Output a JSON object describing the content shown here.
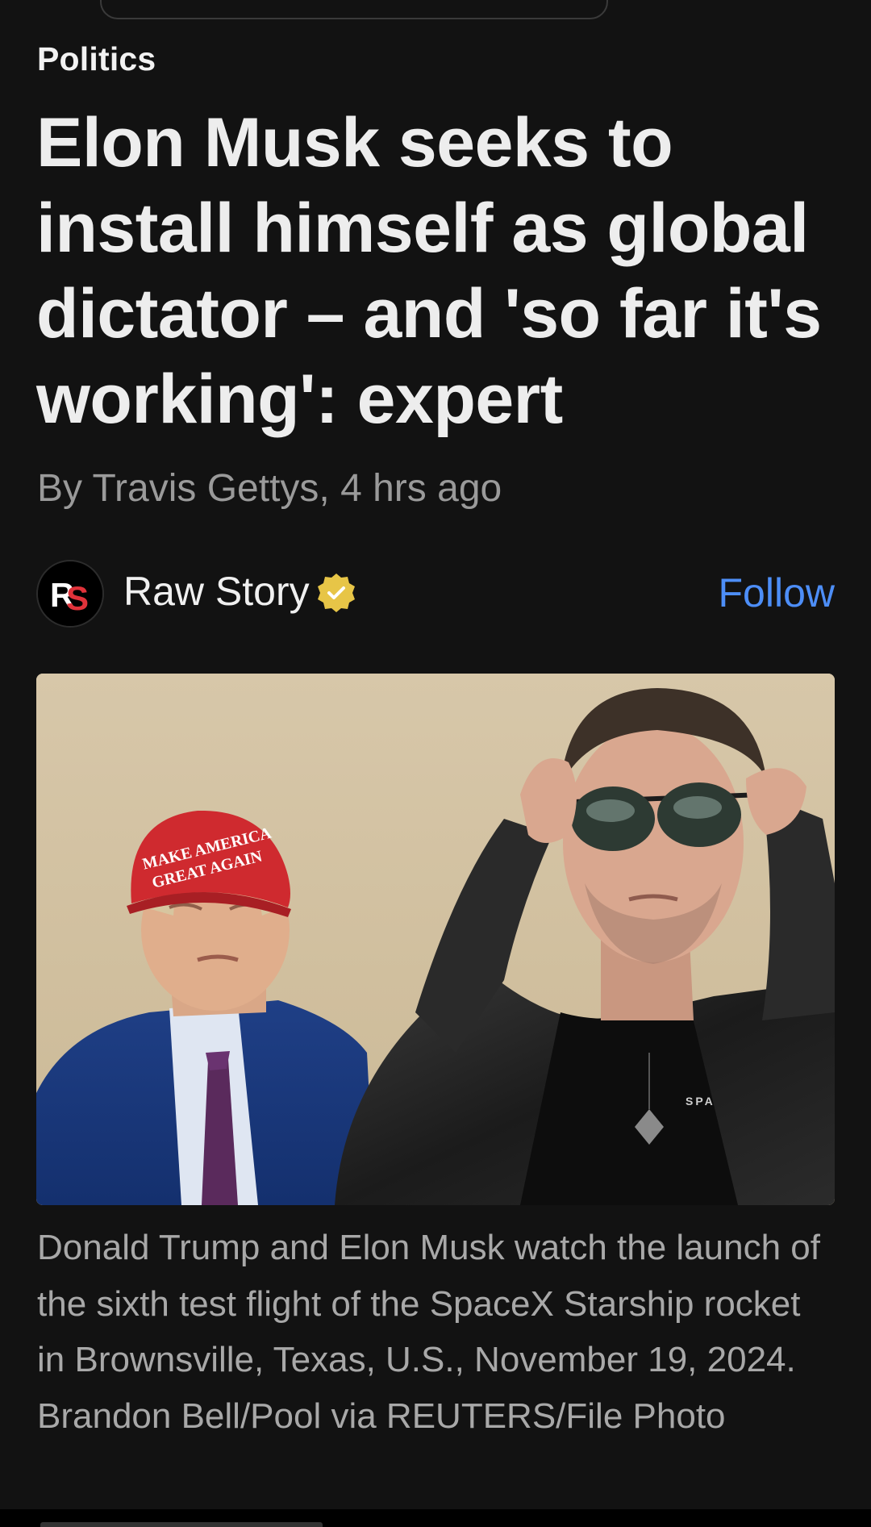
{
  "article": {
    "category": "Politics",
    "headline": "Elon Musk seeks to install himself as global dictator – and 'so far it's working': expert",
    "byline": "By Travis Gettys, 4 hrs ago"
  },
  "source": {
    "name": "Raw Story",
    "logo_text": "RS",
    "verified_icon": "verified-badge-icon",
    "follow_label": "Follow"
  },
  "image": {
    "hat_text_line1": "MAKE AMERICA",
    "hat_text_line2": "GREAT AGAIN",
    "caption": "Donald Trump and Elon Musk watch the launch of the sixth test flight of the SpaceX Starship rocket in Brownsville, Texas, U.S., November 19, 2024. Brandon Bell/Pool via REUTERS/File Photo"
  },
  "colors": {
    "background": "#121212",
    "accent": "#4d8ef7",
    "verified_gold": "#e7c547"
  }
}
